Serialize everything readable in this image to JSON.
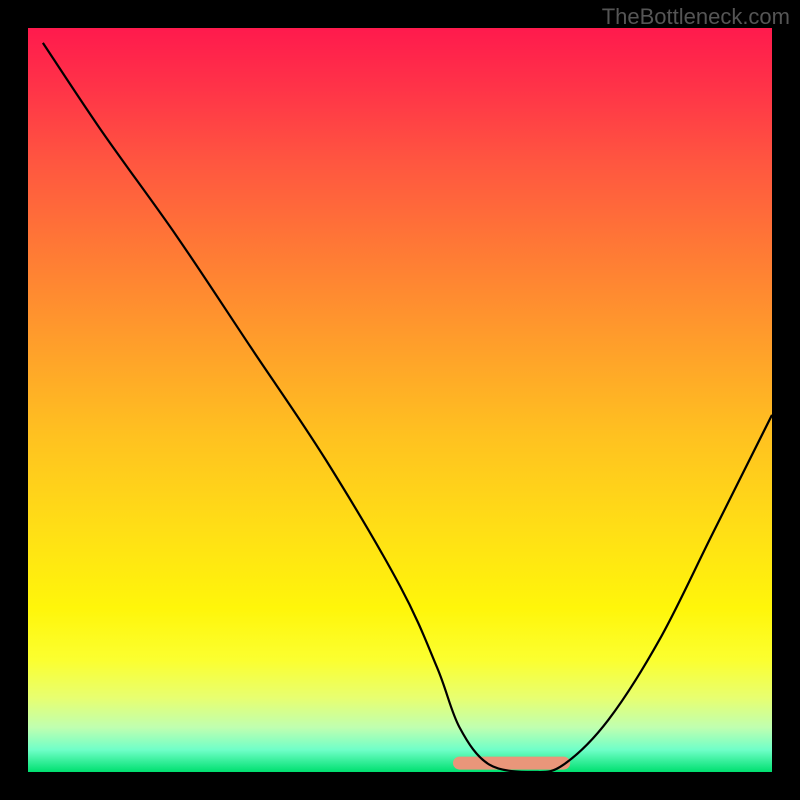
{
  "watermark": "TheBottleneck.com",
  "chart_data": {
    "type": "line",
    "title": "",
    "xlabel": "",
    "ylabel": "",
    "xlim": [
      0,
      100
    ],
    "ylim": [
      0,
      100
    ],
    "series": [
      {
        "name": "curve",
        "x": [
          2,
          10,
          20,
          30,
          40,
          50,
          55,
          58,
          62,
          68,
          72,
          78,
          85,
          92,
          100
        ],
        "values": [
          98,
          86,
          72,
          57,
          42,
          25,
          14,
          6,
          1,
          0,
          1,
          7,
          18,
          32,
          48
        ]
      }
    ],
    "flat_region": {
      "x_start": 58,
      "x_end": 72,
      "y": 1.2
    },
    "background_gradient": {
      "top": "#ff1a4d",
      "mid": "#ffe015",
      "bottom": "#00e070"
    }
  }
}
